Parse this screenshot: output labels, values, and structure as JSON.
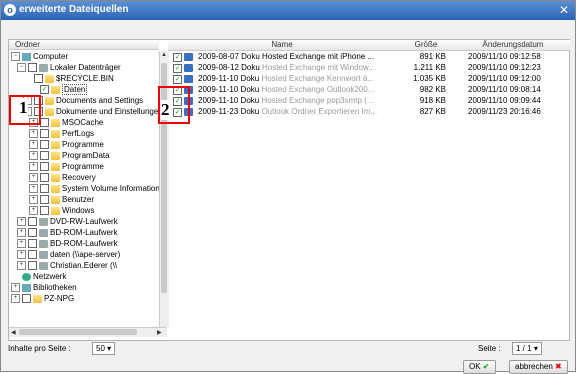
{
  "window": {
    "title": "erweiterte Dateiquellen",
    "close_glyph": "✕"
  },
  "headers": {
    "folder": "Ordner",
    "name": "Name",
    "size": "Größe",
    "modified": "Änderungsdatum"
  },
  "tree": [
    {
      "label": "Computer",
      "icon": "computer-icon",
      "expander": "⊟"
    },
    {
      "label": "Lokaler Datenträger",
      "icon": "drive-icon",
      "expander": "⊟"
    },
    {
      "label": "$RECYCLE.BIN",
      "icon": "folder-icon",
      "expander": ""
    },
    {
      "label": "Daten",
      "icon": "folder-icon",
      "expander": "",
      "checked": true
    },
    {
      "label": "Documents and Settings",
      "icon": "shared-folder-icon",
      "expander": "⊞"
    },
    {
      "label": "Dokumente und Einstellungen",
      "icon": "shared-folder-icon",
      "expander": "⊞"
    },
    {
      "label": "MSOCache",
      "icon": "folder-icon",
      "expander": "⊞"
    },
    {
      "label": "PerfLogs",
      "icon": "folder-icon",
      "expander": "⊞"
    },
    {
      "label": "Programme",
      "icon": "folder-icon",
      "expander": "⊞"
    },
    {
      "label": "ProgramData",
      "icon": "folder-icon",
      "expander": "⊞"
    },
    {
      "label": "Programme",
      "icon": "shared-folder-icon",
      "expander": "⊞"
    },
    {
      "label": "Recovery",
      "icon": "folder-icon",
      "expander": "⊞"
    },
    {
      "label": "System Volume Information",
      "icon": "folder-icon",
      "expander": "⊞"
    },
    {
      "label": "Benutzer",
      "icon": "folder-icon",
      "expander": "⊞"
    },
    {
      "label": "Windows",
      "icon": "folder-icon",
      "expander": "⊞"
    },
    {
      "label": "DVD-RW-Laufwerk",
      "icon": "dvd-drive-icon",
      "expander": "⊞"
    },
    {
      "label": "BD-ROM-Laufwerk",
      "icon": "bd-drive-icon",
      "expander": "⊞"
    },
    {
      "label": "BD-ROM-Laufwerk",
      "icon": "bd-drive-icon",
      "expander": "⊞"
    },
    {
      "label": "daten (\\\\ape-server)",
      "icon": "network-drive-icon",
      "expander": "⊞"
    },
    {
      "label": "Christian.Ederer (\\\\",
      "icon": "network-drive-icon",
      "expander": "⊞"
    },
    {
      "label": "Netzwerk",
      "icon": "network-icon",
      "expander": ""
    },
    {
      "label": "Bibliotheken",
      "icon": "library-icon",
      "expander": "⊞"
    },
    {
      "label": "PZ-NPG",
      "icon": "folder-icon",
      "expander": "⊞"
    }
  ],
  "files": [
    {
      "name": "2009-08-07 Doku",
      "subject": "Hosted Exchange mit iPhone ...",
      "size": "891 KB",
      "date": "2009/11/10 09:12:58",
      "subject_gray": false
    },
    {
      "name": "2009-08-12 Doku",
      "subject": "Hosted Exchange mit Window...",
      "size": "1.211 KB",
      "date": "2009/11/10 09:12:23",
      "subject_gray": true
    },
    {
      "name": "2009-11-10 Doku",
      "subject": "Hosted Exchange Kennwort ä...",
      "size": "1.035 KB",
      "date": "2009/11/10 09:12:00",
      "subject_gray": true
    },
    {
      "name": "2009-11-10 Doku",
      "subject": "Hosted Exchange Outlook200...",
      "size": "982 KB",
      "date": "2009/11/10 09:08:14",
      "subject_gray": true
    },
    {
      "name": "2009-11-10 Doku",
      "subject": "Hosted Exchange pop3smtp (...",
      "size": "918 KB",
      "date": "2009/11/10 09:09:44",
      "subject_gray": true
    },
    {
      "name": "2009-11-23 Doku",
      "subject": "Outlook Ordner Exportieren Im...",
      "size": "827 KB",
      "date": "2009/11/23 20:16:46",
      "subject_gray": true
    }
  ],
  "annotations": {
    "label1": "1",
    "label2": "2"
  },
  "footer": {
    "per_page_label": "Inhalte pro Seite :",
    "per_page_value": "50",
    "page_label": "Seite :",
    "page_value": "1 / 1"
  },
  "buttons": {
    "ok": "OK",
    "cancel": "abbrechen"
  },
  "colors": {
    "title_bar": "#2c63b8",
    "accent_red": "#e00000",
    "ok_green": "#00a000"
  }
}
